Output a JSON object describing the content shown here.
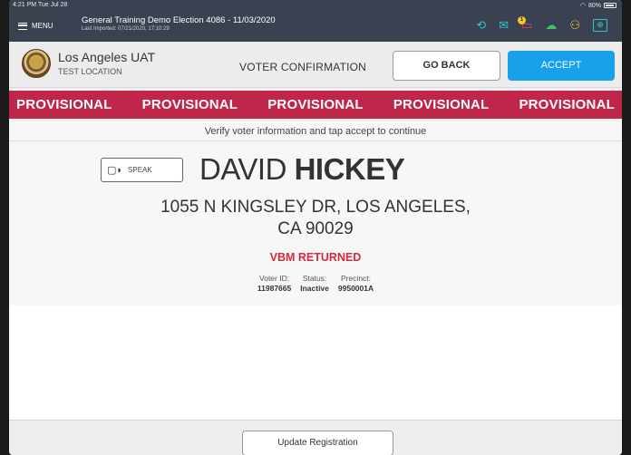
{
  "status": {
    "time": "4:21 PM  Tue Jul 28",
    "battery": "80%"
  },
  "header": {
    "menu_label": "MENU",
    "election_title": "General Training  Demo Election 4086 - 11/03/2020",
    "last_imported": "Last Imported: 07/21/2020, 17:10:29",
    "icons": [
      "history-icon",
      "mail-icon",
      "alert-icon",
      "cloud-icon",
      "users-icon",
      "screen-icon"
    ],
    "notification_count": "1"
  },
  "location": {
    "name": "Los Angeles UAT",
    "sub": "TEST LOCATION",
    "page_title": "VOTER CONFIRMATION",
    "go_back_label": "GO BACK",
    "accept_label": "ACCEPT"
  },
  "banner": {
    "items": [
      "PROVISIONAL",
      "PROVISIONAL",
      "PROVISIONAL",
      "PROVISIONAL",
      "PROVISIONAL"
    ]
  },
  "instruction": "Verify voter information and tap accept to continue",
  "voter": {
    "speak_label": "SPEAK",
    "first_name": "DAVID",
    "last_name": "HICKEY",
    "address_line1": "1055 N KINGSLEY DR, LOS ANGELES,",
    "address_line2": "CA 90029",
    "status_flag": "VBM RETURNED",
    "details": {
      "voter_id_label": "Voter ID:",
      "voter_id": "11987665",
      "status_label": "Status:",
      "status": "Inactive",
      "precinct_label": "Precinct:",
      "precinct": "9950001A"
    }
  },
  "footer": {
    "update_label": "Update Registration"
  },
  "colors": {
    "header_bg": "#3a4150",
    "provisional_red": "#c0254a",
    "accept_blue": "#19a0ea",
    "vbm_red": "#d42a3a"
  }
}
